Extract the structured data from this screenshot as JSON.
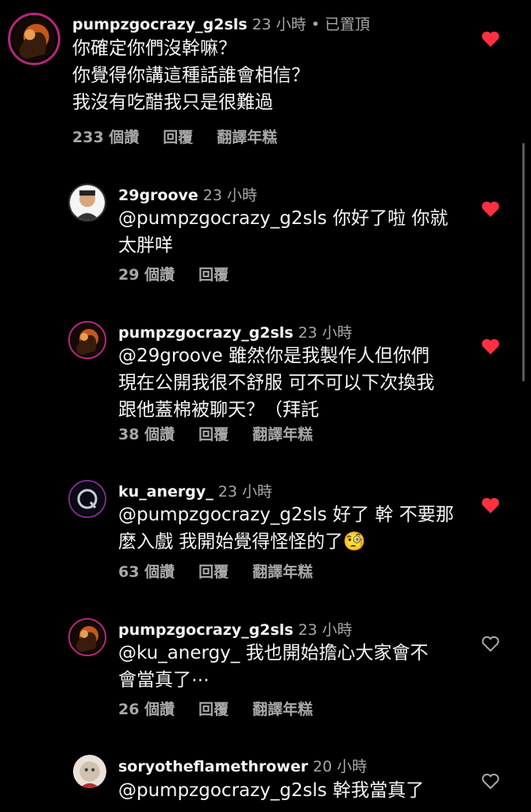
{
  "comments": [
    {
      "username": "pumpzgocrazy_g2sls",
      "meta": "23 小時 • 已置頂",
      "lines": [
        "你確定你們沒幹嘛？",
        "你覺得你講這種話誰會相信？",
        "我沒有吃醋我只是很難過"
      ],
      "likes": "233 個讚",
      "reply": "回覆",
      "translate": "翻譯年糕",
      "liked": true
    },
    {
      "username": "29groove",
      "meta": "23 小時",
      "lines": [
        "@pumpzgocrazy_g2sls 你好了啦 你就",
        "太胖咩"
      ],
      "likes": "29 個讚",
      "reply": "回覆",
      "translate": "",
      "liked": true
    },
    {
      "username": "pumpzgocrazy_g2sls",
      "meta": "23 小時",
      "lines": [
        "@29groove 雖然你是我製作人但你們",
        "現在公開我很不舒服 可不可以下次換我",
        "跟他蓋棉被聊天？（拜託"
      ],
      "likes": "38 個讚",
      "reply": "回覆",
      "translate": "翻譯年糕",
      "liked": true
    },
    {
      "username": "ku_anergy_",
      "meta": "23 小時",
      "lines": [
        "@pumpzgocrazy_g2sls 好了 幹 不要那",
        "麼入戲 我開始覺得怪怪的了🧐"
      ],
      "likes": "63 個讚",
      "reply": "回覆",
      "translate": "翻譯年糕",
      "liked": true
    },
    {
      "username": "pumpzgocrazy_g2sls",
      "meta": "23 小時",
      "lines": [
        "@ku_anergy_ 我也開始擔心大家會不",
        "會當真了⋯"
      ],
      "likes": "26 個讚",
      "reply": "回覆",
      "translate": "翻譯年糕",
      "liked": false
    },
    {
      "username": "soryotheflamethrower",
      "meta": "20 小時",
      "lines": [
        "@pumpzgocrazy_g2sls 幹我當真了"
      ],
      "likes": "",
      "reply": "",
      "translate": "",
      "liked": false
    }
  ],
  "colors": {
    "liked": "#ff3040",
    "meta": "#a8a8a8",
    "ring": "#b8267a"
  },
  "icons": {
    "heart_filled": "heart-filled-icon",
    "heart_outline": "heart-outline-icon"
  }
}
